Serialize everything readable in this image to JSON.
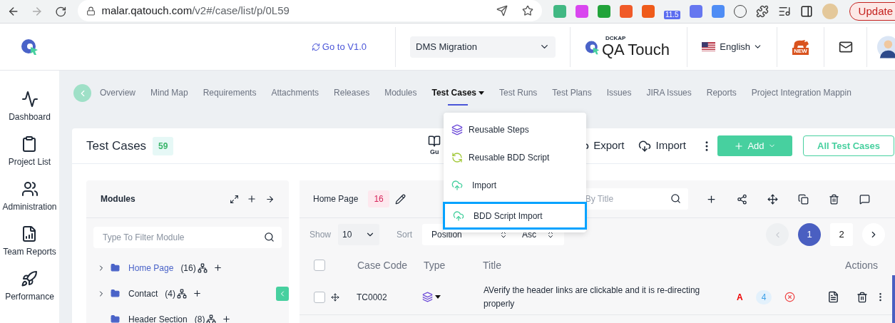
{
  "browser": {
    "url_host": "malar.qatouch.com",
    "url_path": "/v2#/case/list/p/0L59",
    "extension_badge": "11.5",
    "update_button": "Update"
  },
  "header": {
    "version_link": "Go to V1.0",
    "project_select": "DMS Migration",
    "brand_top": "DCKAP",
    "brand_name": "QA Touch",
    "language": "English",
    "new_badge": "NEW"
  },
  "sidebar": {
    "items": [
      {
        "label": "Dashboard",
        "kind": "pulse"
      },
      {
        "label": "Project List",
        "kind": "clipboard"
      },
      {
        "label": "Administration",
        "kind": "users"
      },
      {
        "label": "Team Reports",
        "kind": "report"
      },
      {
        "label": "Performance",
        "kind": "rocket"
      }
    ]
  },
  "tabs": [
    {
      "label": "Overview",
      "selected": false,
      "dropdown": false
    },
    {
      "label": "Mind Map",
      "selected": false,
      "dropdown": false
    },
    {
      "label": "Requirements",
      "selected": false,
      "dropdown": false
    },
    {
      "label": "Attachments",
      "selected": false,
      "dropdown": false
    },
    {
      "label": "Releases",
      "selected": false,
      "dropdown": false
    },
    {
      "label": "Modules",
      "selected": false,
      "dropdown": false
    },
    {
      "label": "Test Cases",
      "selected": true,
      "dropdown": true
    },
    {
      "label": "Test Runs",
      "selected": false,
      "dropdown": false
    },
    {
      "label": "Test Plans",
      "selected": false,
      "dropdown": false
    },
    {
      "label": "Issues",
      "selected": false,
      "dropdown": false
    },
    {
      "label": "JIRA Issues",
      "selected": false,
      "dropdown": false
    },
    {
      "label": "Reports",
      "selected": false,
      "dropdown": false
    },
    {
      "label": "Project Integration Mappin",
      "selected": false,
      "dropdown": false
    }
  ],
  "menu": {
    "items": [
      {
        "label": "Reusable Steps",
        "kind": "steps",
        "selected": false
      },
      {
        "label": "Reusable BDD Script",
        "kind": "cycle",
        "selected": false
      },
      {
        "label": "Import",
        "kind": "upload",
        "selected": false
      },
      {
        "label": "BDD Script Import",
        "kind": "upload",
        "selected": true
      }
    ]
  },
  "card": {
    "title": "Test Cases",
    "count": "59",
    "actions": [
      {
        "label": "Gu",
        "kind": "guide"
      },
      {
        "label": "Export",
        "kind": "export"
      },
      {
        "label": "Import",
        "kind": "import"
      }
    ],
    "add_button": "Add",
    "all_button": "All Test Cases"
  },
  "modules": {
    "title": "Modules",
    "filter_placeholder": "Type To Filter Module",
    "tree": [
      {
        "label": "Home Page",
        "count": "(16)",
        "selected": true,
        "has_children": true
      },
      {
        "label": "Contact",
        "count": "(4)",
        "selected": false,
        "has_children": true
      },
      {
        "label": "Header Section",
        "count": "(8)",
        "selected": false,
        "has_children": false
      }
    ]
  },
  "cases": {
    "module": "Home Page",
    "count": "16",
    "search_placeholder": "By Title",
    "show_label": "Show",
    "show_value": "10",
    "sort_label": "Sort",
    "sort_value": "Position",
    "order_value": "Asc",
    "prev_disabled": true,
    "select_all_checked": false,
    "pages": [
      {
        "label": "1",
        "selected": true
      },
      {
        "label": "2",
        "selected": false
      }
    ],
    "columns": [
      "Case Code",
      "Type",
      "Title",
      "Actions"
    ],
    "rows": [
      {
        "checked": false,
        "code": "TC0002",
        "title": "AVerify the header links are clickable and it is re-directing properly",
        "priority": "A",
        "steps": "4"
      }
    ]
  }
}
